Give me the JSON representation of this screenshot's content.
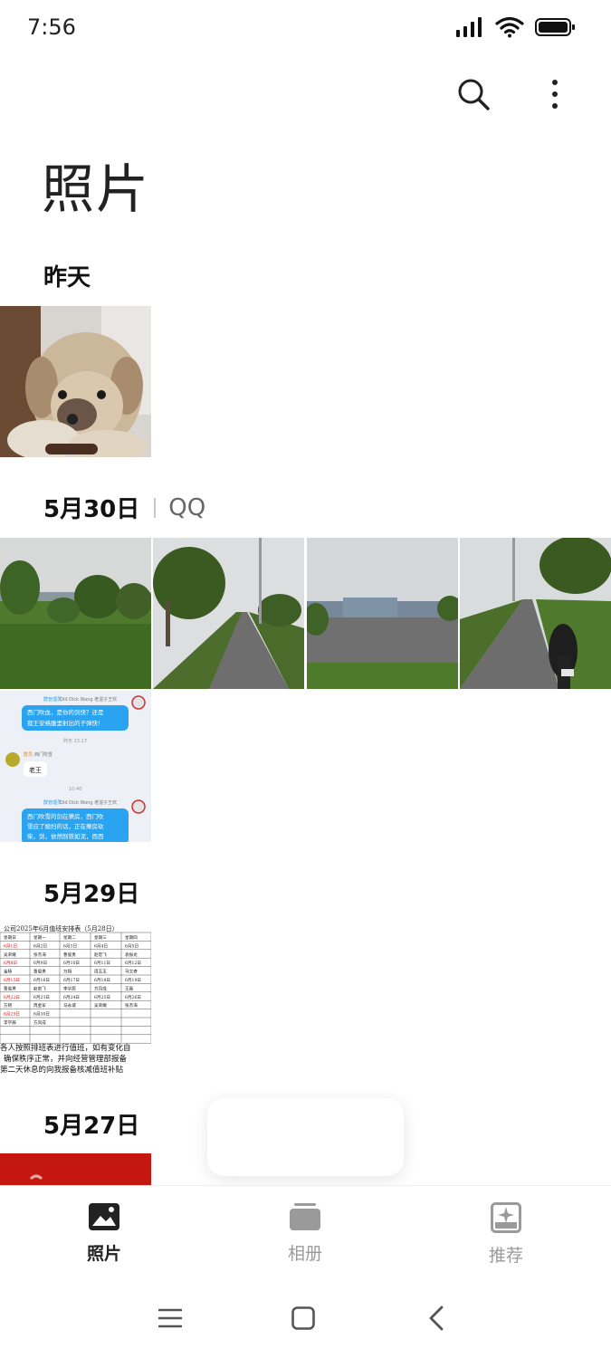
{
  "status_bar": {
    "time": "7:56"
  },
  "header": {
    "title": "照片"
  },
  "sections": [
    {
      "date": "昨天"
    },
    {
      "date": "5月30日",
      "source": "QQ"
    },
    {
      "date": "5月29日"
    },
    {
      "date": "5月27日"
    }
  ],
  "chat_screenshot": {
    "tag1": "群管理员",
    "name1": "Old Dick Wang 老湿子王欢",
    "bubble1": "西门吹血，是你的剑快？还是我王安格腹里射出的子弹快！",
    "time1": "昨天 23:17",
    "tag2": "群员",
    "name2": "西门吹雪",
    "bubble2": "老王",
    "time2": "10:40",
    "bubble3": "西门吹雪的剑在樂房，西门吹雪应了媳妇的话，正在樂房砍柴，剑，依然削铁如泥，而西"
  },
  "schedule_doc": {
    "title": "公司2025年6月值班安排表（5月28日）",
    "header_row": [
      "星期日",
      "星期一",
      "星期二",
      "星期三",
      "星期四"
    ],
    "rows": [
      [
        "6月1日",
        "6月2日",
        "6月3日",
        "6月4日",
        "6月5日"
      ],
      [
        "吴荣耀",
        "张杰海",
        "曹俊勇",
        "赵宏飞",
        "袁振龙"
      ],
      [
        "6月8日",
        "6月9日",
        "6月10日",
        "6月11日",
        "6月12日"
      ],
      [
        "金杨",
        "曹俊勇",
        "万翔",
        "周玉玉",
        "马文奇"
      ],
      [
        "6月15日",
        "6月16日",
        "6月17日",
        "6月18日",
        "6月19日"
      ],
      [
        "曹俊勇",
        "赵宏飞",
        "李学辰",
        "方凤成",
        "王磊"
      ],
      [
        "6月22日",
        "6月23日",
        "6月24日",
        "6月25日",
        "6月26日"
      ],
      [
        "方舸",
        "周金军",
        "马永城",
        "吴荣耀",
        "张杰海"
      ],
      [
        "6月29日",
        "6月30日",
        "",
        "",
        ""
      ],
      [
        "李学辰",
        "方凤成",
        "",
        "",
        ""
      ]
    ],
    "footer1": "各人按照排班表进行值班，如有变化自",
    "footer2": "确保秩序正常，并向经营管理部报备",
    "footer3": "第二天休息的向我报备核减值班补贴"
  },
  "bottom_nav": [
    {
      "label": "照片",
      "icon": "photos-icon",
      "active": true
    },
    {
      "label": "相册",
      "icon": "albums-icon",
      "active": false
    },
    {
      "label": "推荐",
      "icon": "recommend-icon",
      "active": false
    }
  ],
  "colors": {
    "accent": "#222222",
    "inactive": "#9a9a9a",
    "bubble": "#2aa3f0"
  }
}
